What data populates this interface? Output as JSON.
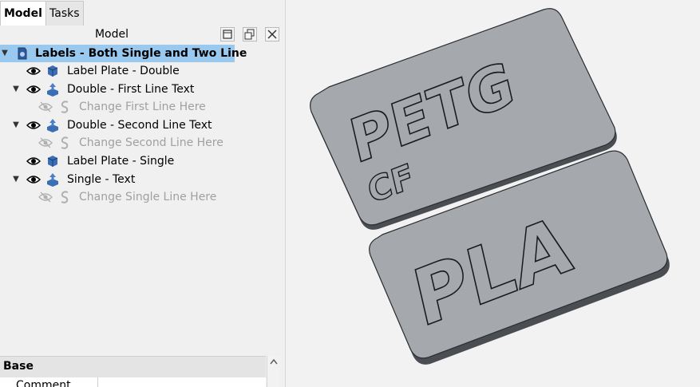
{
  "tabs": [
    {
      "label": "Model",
      "active": true
    },
    {
      "label": "Tasks",
      "active": false
    }
  ],
  "model_panel": {
    "title": "Model",
    "buttons": [
      "restore-icon",
      "float-icon",
      "close-icon"
    ]
  },
  "tree": {
    "root": {
      "label": "Labels - Both Single and Two Line",
      "selected": true
    },
    "items": [
      {
        "label": "Label Plate - Double",
        "icon": "cube-icon",
        "visible": true
      },
      {
        "label": "Double - First Line Text",
        "icon": "extrude-icon",
        "visible": true,
        "expanded": true
      },
      {
        "label": "Change First Line Here",
        "icon": "shapestring-icon",
        "visible": false
      },
      {
        "label": "Double - Second Line Text",
        "icon": "extrude-icon",
        "visible": true,
        "expanded": true
      },
      {
        "label": "Change Second Line Here",
        "icon": "shapestring-icon",
        "visible": false
      },
      {
        "label": "Label Plate - Single",
        "icon": "cube-icon",
        "visible": true
      },
      {
        "label": "Single - Text",
        "icon": "extrude-icon",
        "visible": true,
        "expanded": true
      },
      {
        "label": "Change Single Line Here",
        "icon": "shapestring-icon",
        "visible": false
      }
    ]
  },
  "properties": {
    "group": "Base",
    "first_row": "Comment"
  },
  "viewport": {
    "plate_color": "#a5a9ae",
    "plate_top_text_line1": "PETG",
    "plate_top_text_line2": "CF",
    "plate_bottom_text": "PLA"
  }
}
